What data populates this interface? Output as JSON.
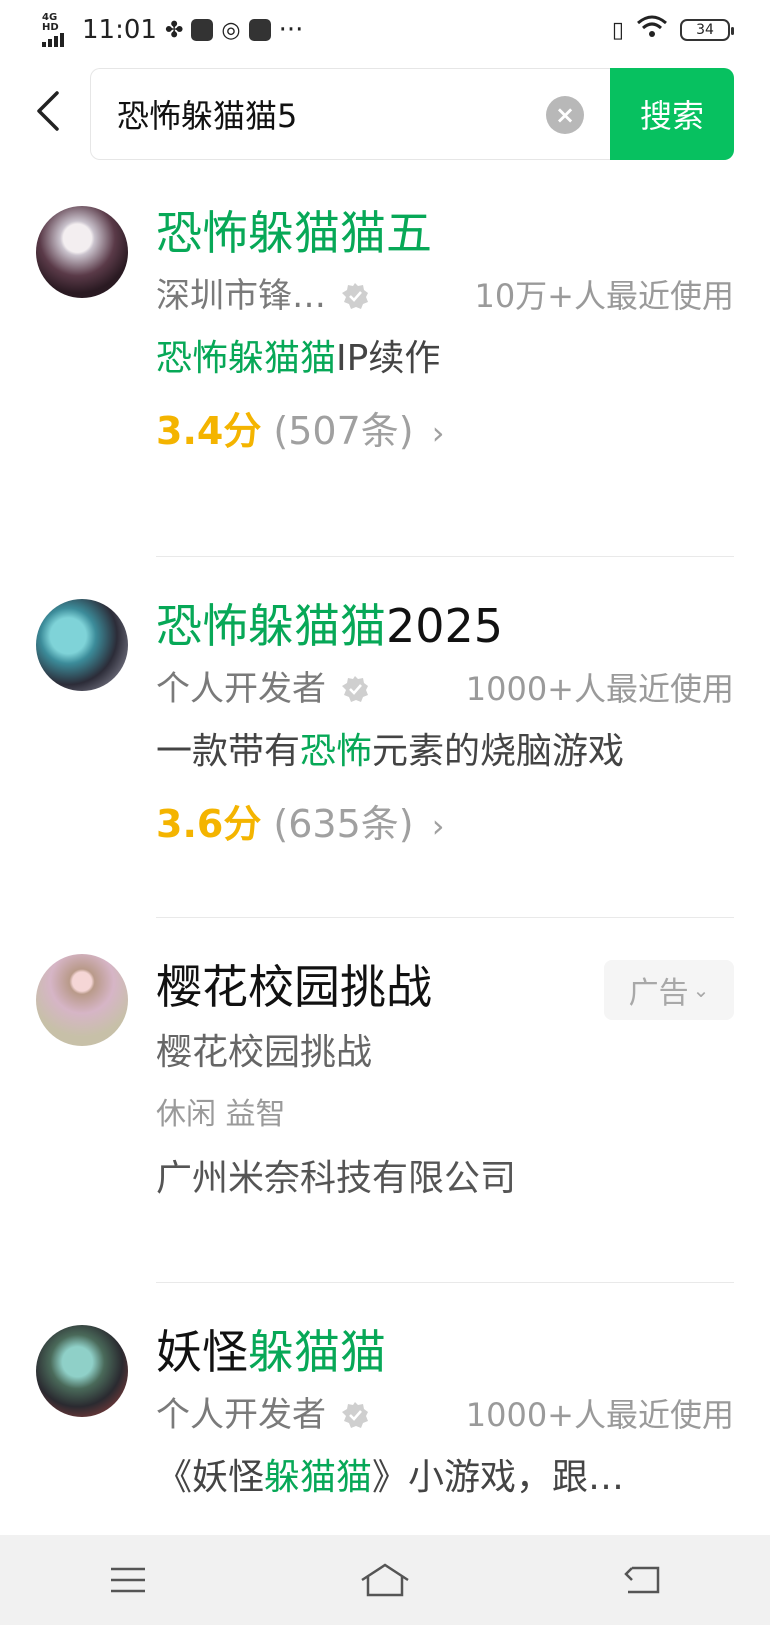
{
  "status_bar": {
    "network": "4G HD",
    "time": "11:01",
    "more": "···",
    "battery": "34",
    "icons": [
      "signal-icon",
      "pinwheel-icon",
      "message-icon",
      "app-icon",
      "play-icon",
      "vibrate-icon",
      "wifi-icon",
      "battery-icon"
    ]
  },
  "search": {
    "query": "恐怖躲猫猫5",
    "clear_glyph": "×",
    "button_label": "搜索"
  },
  "results": [
    {
      "title_parts": [
        {
          "text": "恐怖躲猫猫五",
          "hl": true
        }
      ],
      "developer": "深圳市锋…",
      "users": "10万+人最近使用",
      "desc_parts": [
        {
          "text": "恐怖躲猫猫",
          "hl": true
        },
        {
          "text": "IP续作",
          "hl": false
        }
      ],
      "score": "3.4分",
      "count": "(507条)",
      "chevron": "›"
    },
    {
      "title_parts": [
        {
          "text": "恐怖躲猫猫",
          "hl": true
        },
        {
          "text": "2025",
          "hl": false
        }
      ],
      "developer": "个人开发者",
      "users": "1000+人最近使用",
      "desc_parts": [
        {
          "text": "一款带有",
          "hl": false
        },
        {
          "text": "恐怖",
          "hl": true
        },
        {
          "text": "元素的烧脑游戏",
          "hl": false
        }
      ],
      "score": "3.6分",
      "count": "(635条)",
      "chevron": "›"
    },
    {
      "title": "樱花校园挑战",
      "subtitle": "樱花校园挑战",
      "tags": "休闲 益智",
      "company": "广州米奈科技有限公司",
      "ad_label": "广告",
      "ad_chevron": "⌄"
    },
    {
      "title_parts": [
        {
          "text": "妖怪",
          "hl": false
        },
        {
          "text": "躲猫猫",
          "hl": true
        }
      ],
      "developer": "个人开发者",
      "users": "1000+人最近使用",
      "desc_parts": [
        {
          "text": "《妖怪",
          "hl": false
        },
        {
          "text": "躲猫猫",
          "hl": true
        },
        {
          "text": "》小游戏，跟…",
          "hl": false
        }
      ]
    }
  ],
  "colors": {
    "accent": "#07c160",
    "highlight": "#07a857",
    "rating": "#f4b400"
  }
}
